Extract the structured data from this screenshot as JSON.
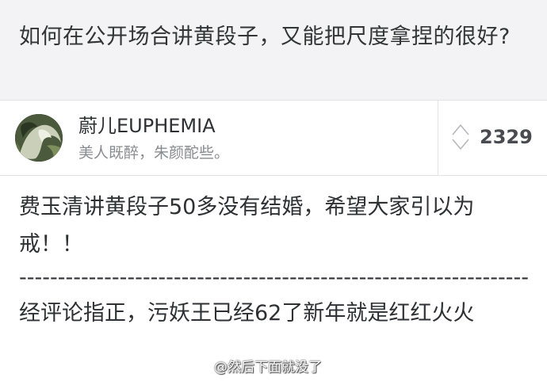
{
  "question": {
    "title": "如何在公开场合讲黄段子，又能把尺度拿捏的很好?"
  },
  "answer": {
    "author_name": "蔚儿EUPHEMIA",
    "author_bio": "美人既醉，朱颜酡些。",
    "vote_count": "2329",
    "paragraph_1": "费玉清讲黄段子50多没有结婚，希望大家引以为戒！！",
    "divider": "------------------------------------------------------------------",
    "paragraph_2": "经评论指正，污妖王已经62了新年就是红红火火"
  },
  "watermark": {
    "text": "@然后下面就没了"
  },
  "icons": {
    "vote": "up-down-arrow-icon",
    "avatar": "user-avatar"
  },
  "colors": {
    "question_bg": "#f3f3f5",
    "text_primary": "#2f3034",
    "text_secondary": "#8a8b90",
    "divider": "#e2e2e6"
  }
}
